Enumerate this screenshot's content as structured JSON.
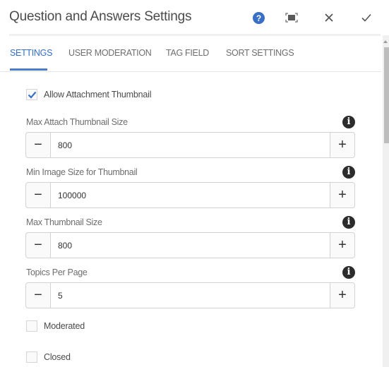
{
  "dialog": {
    "title": "Question and Answers Settings",
    "icons": {
      "help": "help-icon",
      "fullscreen": "fullscreen-icon",
      "close": "close-icon",
      "done": "checkmark-icon"
    },
    "accent_color": "#326ec8"
  },
  "tabs": [
    {
      "label": "SETTINGS",
      "active": true
    },
    {
      "label": "USER MODERATION",
      "active": false
    },
    {
      "label": "TAG FIELD",
      "active": false
    },
    {
      "label": "SORT SETTINGS",
      "active": false
    }
  ],
  "settings": {
    "allow_attachment_thumbnail": {
      "label": "Allow Attachment Thumbnail",
      "checked": true
    },
    "fields": [
      {
        "label": "Max Attach Thumbnail Size",
        "value": "800"
      },
      {
        "label": "Min Image Size for Thumbnail",
        "value": "100000"
      },
      {
        "label": "Max Thumbnail Size",
        "value": "800"
      },
      {
        "label": "Topics Per Page",
        "value": "5"
      }
    ],
    "moderated": {
      "label": "Moderated",
      "checked": false
    },
    "closed": {
      "label": "Closed",
      "checked": false
    }
  },
  "stepper": {
    "minus": "−",
    "plus": "+"
  },
  "info_glyph": "i"
}
